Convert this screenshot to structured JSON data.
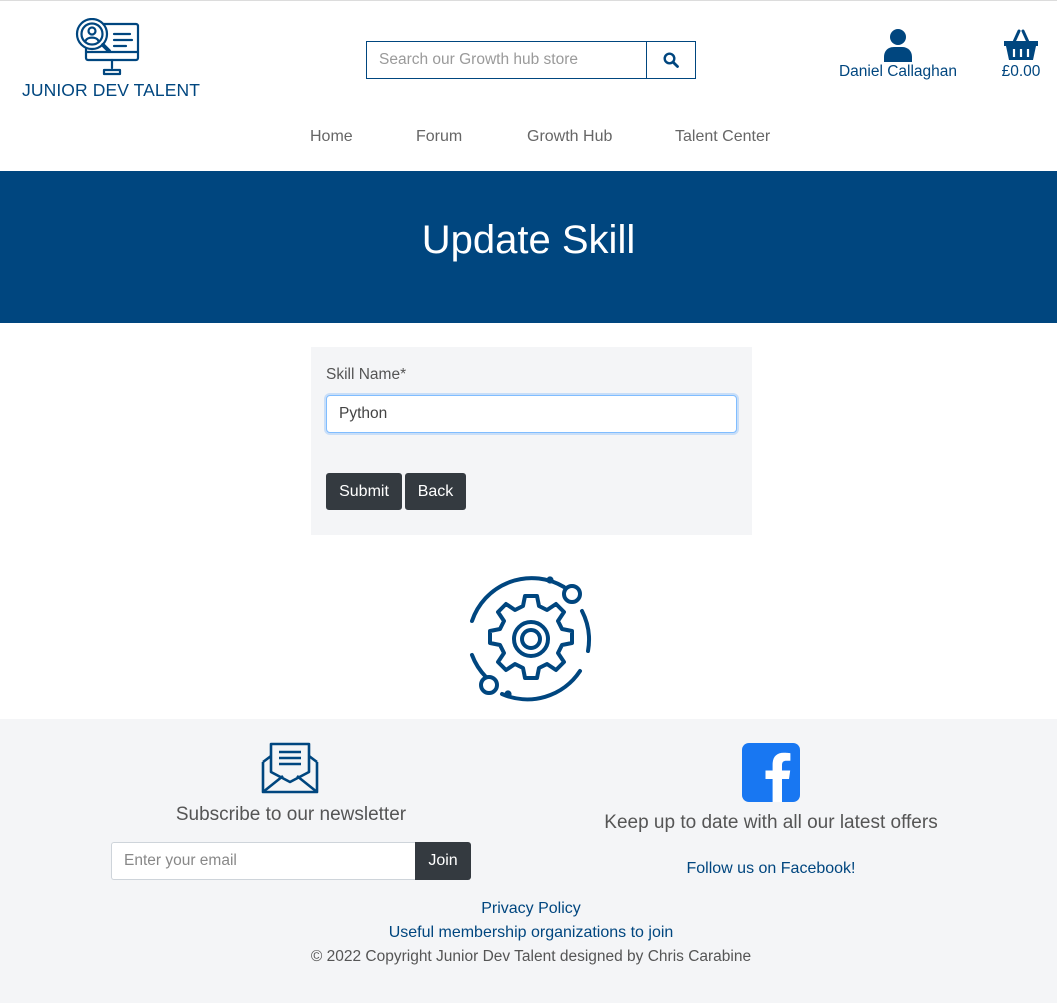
{
  "brand": {
    "name": "JUNIOR DEV TALENT",
    "color": "#00467f"
  },
  "search": {
    "placeholder": "Search our Growth hub store",
    "icon": "search-icon"
  },
  "account": {
    "name": "Daniel Callaghan",
    "icon": "user-icon"
  },
  "cart": {
    "total": "£0.00",
    "icon": "basket-icon"
  },
  "nav": {
    "items": [
      "Home",
      "Forum",
      "Growth Hub",
      "Talent Center"
    ]
  },
  "hero": {
    "title": "Update Skill",
    "background": "#00467f"
  },
  "form": {
    "skill_label": "Skill Name*",
    "skill_value": "Python",
    "submit_label": "Submit",
    "back_label": "Back"
  },
  "footer": {
    "newsletter": {
      "title": "Subscribe to our newsletter",
      "placeholder": "Enter your email",
      "join_label": "Join"
    },
    "social": {
      "title": "Keep up to date with all our latest offers",
      "link": "Follow us on Facebook!"
    },
    "links": [
      "Privacy Policy",
      "Useful membership organizations to join"
    ],
    "copyright": "© 2022 Copyright Junior Dev Talent designed by Chris Carabine"
  }
}
